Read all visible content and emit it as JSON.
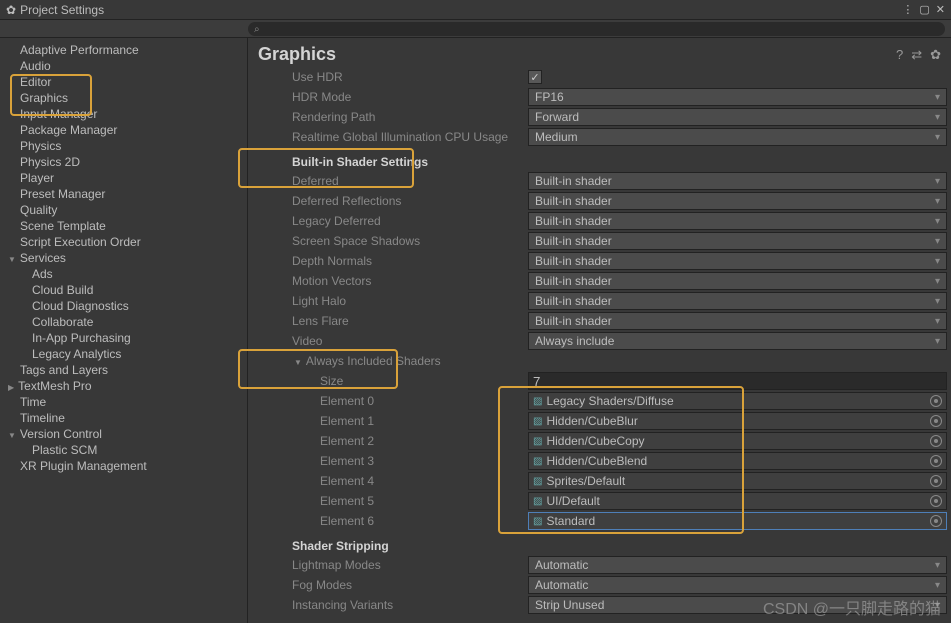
{
  "window": {
    "title": "Project Settings"
  },
  "search": {
    "placeholder": ""
  },
  "sidebar": {
    "items": [
      {
        "label": "Adaptive Performance"
      },
      {
        "label": "Audio"
      },
      {
        "label": "Editor"
      },
      {
        "label": "Graphics"
      },
      {
        "label": "Input Manager"
      },
      {
        "label": "Package Manager"
      },
      {
        "label": "Physics"
      },
      {
        "label": "Physics 2D"
      },
      {
        "label": "Player"
      },
      {
        "label": "Preset Manager"
      },
      {
        "label": "Quality"
      },
      {
        "label": "Scene Template"
      },
      {
        "label": "Script Execution Order"
      },
      {
        "label": "Services",
        "expanded": true,
        "children": [
          {
            "label": "Ads"
          },
          {
            "label": "Cloud Build"
          },
          {
            "label": "Cloud Diagnostics"
          },
          {
            "label": "Collaborate"
          },
          {
            "label": "In-App Purchasing"
          },
          {
            "label": "Legacy Analytics"
          }
        ]
      },
      {
        "label": "Tags and Layers"
      },
      {
        "label": "TextMesh Pro",
        "collapsed": true
      },
      {
        "label": "Time"
      },
      {
        "label": "Timeline"
      },
      {
        "label": "Version Control",
        "expanded": true,
        "children": [
          {
            "label": "Plastic SCM"
          }
        ]
      },
      {
        "label": "XR Plugin Management"
      }
    ]
  },
  "main": {
    "title": "Graphics",
    "top_rows": [
      {
        "label": "Use HDR",
        "type": "check",
        "value": true
      },
      {
        "label": "HDR Mode",
        "type": "dd",
        "value": "FP16"
      },
      {
        "label": "Rendering Path",
        "type": "dd",
        "value": "Forward"
      },
      {
        "label": "Realtime Global Illumination CPU Usage",
        "type": "dd",
        "value": "Medium"
      }
    ],
    "builtin_header": "Built-in Shader Settings",
    "builtin_rows": [
      {
        "label": "Deferred",
        "value": "Built-in shader"
      },
      {
        "label": "Deferred Reflections",
        "value": "Built-in shader"
      },
      {
        "label": "Legacy Deferred",
        "value": "Built-in shader"
      },
      {
        "label": "Screen Space Shadows",
        "value": "Built-in shader"
      },
      {
        "label": "Depth Normals",
        "value": "Built-in shader"
      },
      {
        "label": "Motion Vectors",
        "value": "Built-in shader"
      },
      {
        "label": "Light Halo",
        "value": "Built-in shader"
      },
      {
        "label": "Lens Flare",
        "value": "Built-in shader"
      },
      {
        "label": "Video",
        "value": "Always include"
      }
    ],
    "ais_header": "Always Included Shaders",
    "ais_size_label": "Size",
    "ais_size": "7",
    "ais_elems": [
      {
        "label": "Element 0",
        "value": "Legacy Shaders/Diffuse"
      },
      {
        "label": "Element 1",
        "value": "Hidden/CubeBlur"
      },
      {
        "label": "Element 2",
        "value": "Hidden/CubeCopy"
      },
      {
        "label": "Element 3",
        "value": "Hidden/CubeBlend"
      },
      {
        "label": "Element 4",
        "value": "Sprites/Default"
      },
      {
        "label": "Element 5",
        "value": "UI/Default"
      },
      {
        "label": "Element 6",
        "value": "Standard",
        "selected": true,
        "link": true
      }
    ],
    "stripping_header": "Shader Stripping",
    "stripping_rows": [
      {
        "label": "Lightmap Modes",
        "value": "Automatic"
      },
      {
        "label": "Fog Modes",
        "value": "Automatic"
      },
      {
        "label": "Instancing Variants",
        "value": "Strip Unused"
      }
    ]
  },
  "watermark": "CSDN @一只脚走路的猫"
}
